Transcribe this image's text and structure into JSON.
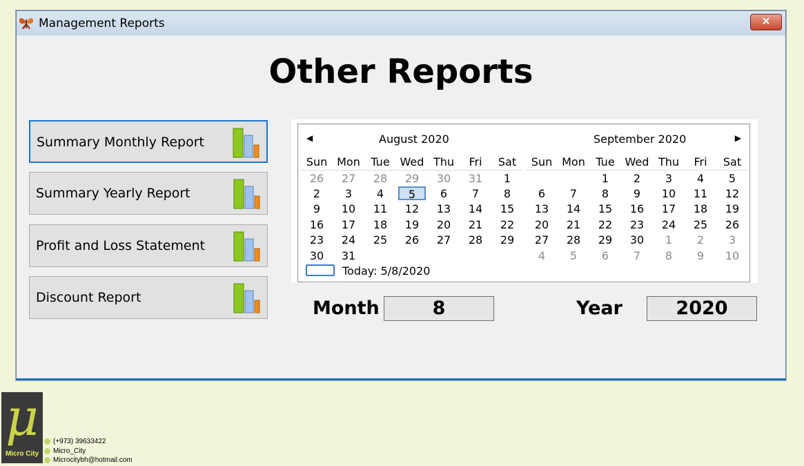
{
  "window": {
    "title": "Management Reports",
    "close_label": "✕"
  },
  "heading": "Other Reports",
  "report_buttons": [
    {
      "label": "Summary Monthly Report",
      "icon": "bar-chart-icon"
    },
    {
      "label": "Summary Yearly Report",
      "icon": "bar-chart-icon"
    },
    {
      "label": "Profit and Loss Statement",
      "icon": "bar-chart-icon"
    },
    {
      "label": "Discount Report",
      "icon": "bar-chart-icon"
    }
  ],
  "calendar": {
    "prev_arrow": "◀",
    "next_arrow": "▶",
    "months": [
      {
        "header": "August 2020",
        "days": [
          "Sun",
          "Mon",
          "Tue",
          "Wed",
          "Thu",
          "Fri",
          "Sat"
        ],
        "weeks": [
          [
            [
              "26",
              1
            ],
            [
              "27",
              1
            ],
            [
              "28",
              1
            ],
            [
              "29",
              1
            ],
            [
              "30",
              1
            ],
            [
              "31",
              1
            ],
            [
              "1",
              0
            ]
          ],
          [
            [
              "2",
              0
            ],
            [
              "3",
              0
            ],
            [
              "4",
              0
            ],
            [
              "5",
              2
            ],
            [
              "6",
              0
            ],
            [
              "7",
              0
            ],
            [
              "8",
              0
            ]
          ],
          [
            [
              "9",
              0
            ],
            [
              "10",
              0
            ],
            [
              "11",
              0
            ],
            [
              "12",
              0
            ],
            [
              "13",
              0
            ],
            [
              "14",
              0
            ],
            [
              "15",
              0
            ]
          ],
          [
            [
              "16",
              0
            ],
            [
              "17",
              0
            ],
            [
              "18",
              0
            ],
            [
              "19",
              0
            ],
            [
              "20",
              0
            ],
            [
              "21",
              0
            ],
            [
              "22",
              0
            ]
          ],
          [
            [
              "23",
              0
            ],
            [
              "24",
              0
            ],
            [
              "25",
              0
            ],
            [
              "26",
              0
            ],
            [
              "27",
              0
            ],
            [
              "28",
              0
            ],
            [
              "29",
              0
            ]
          ],
          [
            [
              "30",
              0
            ],
            [
              "31",
              0
            ],
            [
              "",
              0
            ],
            [
              "",
              0
            ],
            [
              "",
              0
            ],
            [
              "",
              0
            ],
            [
              "",
              0
            ]
          ]
        ]
      },
      {
        "header": "September 2020",
        "days": [
          "Sun",
          "Mon",
          "Tue",
          "Wed",
          "Thu",
          "Fri",
          "Sat"
        ],
        "weeks": [
          [
            [
              "",
              0
            ],
            [
              "",
              0
            ],
            [
              "1",
              0
            ],
            [
              "2",
              0
            ],
            [
              "3",
              0
            ],
            [
              "4",
              0
            ],
            [
              "5",
              0
            ]
          ],
          [
            [
              "6",
              0
            ],
            [
              "7",
              0
            ],
            [
              "8",
              0
            ],
            [
              "9",
              0
            ],
            [
              "10",
              0
            ],
            [
              "11",
              0
            ],
            [
              "12",
              0
            ]
          ],
          [
            [
              "13",
              0
            ],
            [
              "14",
              0
            ],
            [
              "15",
              0
            ],
            [
              "16",
              0
            ],
            [
              "17",
              0
            ],
            [
              "18",
              0
            ],
            [
              "19",
              0
            ]
          ],
          [
            [
              "20",
              0
            ],
            [
              "21",
              0
            ],
            [
              "22",
              0
            ],
            [
              "23",
              0
            ],
            [
              "24",
              0
            ],
            [
              "25",
              0
            ],
            [
              "26",
              0
            ]
          ],
          [
            [
              "27",
              0
            ],
            [
              "28",
              0
            ],
            [
              "29",
              0
            ],
            [
              "30",
              0
            ],
            [
              "1",
              1
            ],
            [
              "2",
              1
            ],
            [
              "3",
              1
            ]
          ],
          [
            [
              "4",
              1
            ],
            [
              "5",
              1
            ],
            [
              "6",
              1
            ],
            [
              "7",
              1
            ],
            [
              "8",
              1
            ],
            [
              "9",
              1
            ],
            [
              "10",
              1
            ]
          ]
        ]
      }
    ],
    "today_label": "Today: 5/8/2020"
  },
  "fields": {
    "month_label": "Month",
    "month_value": "8",
    "year_label": "Year",
    "year_value": "2020"
  },
  "branding": {
    "logo_glyph": "μ",
    "logo_name": "Micro City",
    "phone": "(+973) 39633422",
    "handle": "Micro_City",
    "email": "Microcitybh@hotmail.com"
  }
}
